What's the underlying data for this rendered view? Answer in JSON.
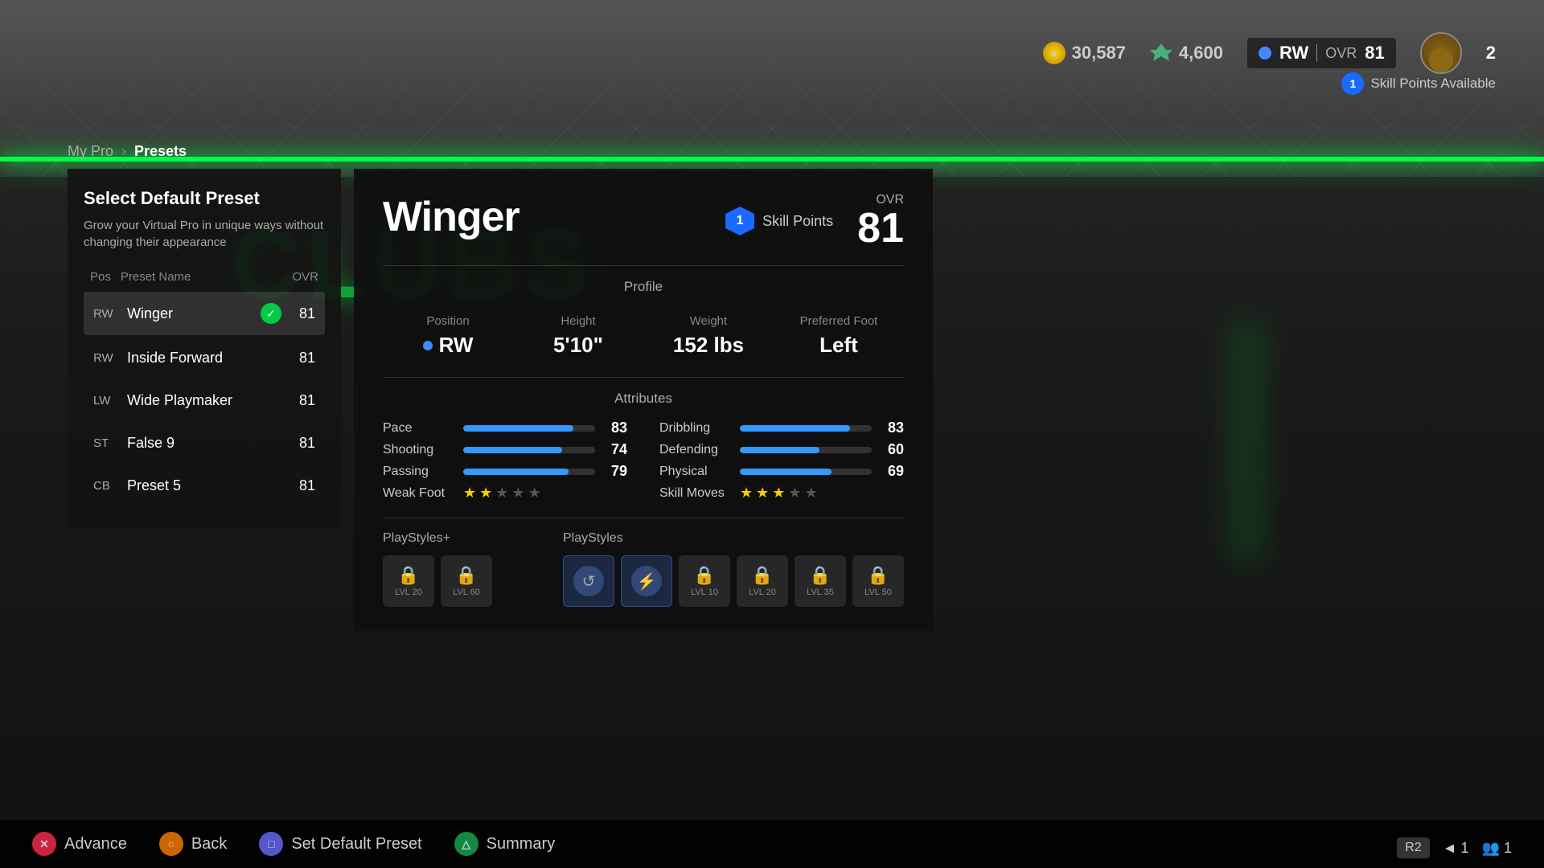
{
  "background": {
    "clubsText": "CLUBS"
  },
  "topHud": {
    "currency1": "30,587",
    "currency2": "4,600",
    "playerPos": "RW",
    "ovrLabel": "OVR",
    "ovrValue": "81",
    "playerNumber": "2",
    "skillPointsAvailLabel": "Skill Points Available",
    "skillPointsCount": "1"
  },
  "breadcrumb": {
    "root": "My Pro",
    "current": "Presets"
  },
  "leftPanel": {
    "title": "Select Default Preset",
    "description": "Grow your Virtual Pro in unique ways without changing their appearance",
    "headers": {
      "pos": "Pos",
      "name": "Preset Name",
      "ovr": "OVR"
    },
    "presets": [
      {
        "pos": "RW",
        "name": "Winger",
        "ovr": "81",
        "selected": true
      },
      {
        "pos": "RW",
        "name": "Inside Forward",
        "ovr": "81",
        "selected": false
      },
      {
        "pos": "LW",
        "name": "Wide Playmaker",
        "ovr": "81",
        "selected": false
      },
      {
        "pos": "ST",
        "name": "False 9",
        "ovr": "81",
        "selected": false
      },
      {
        "pos": "CB",
        "name": "Preset 5",
        "ovr": "81",
        "selected": false
      }
    ]
  },
  "mainCard": {
    "title": "Winger",
    "skillPointsBadgeNum": "1",
    "skillPointsLabel": "Skill Points",
    "ovrLabel": "OVR",
    "ovrValue": "81",
    "profileLabel": "Profile",
    "profile": {
      "posLabel": "Position",
      "posValue": "RW",
      "heightLabel": "Height",
      "heightValue": "5'10\"",
      "weightLabel": "Weight",
      "weightValue": "152 lbs",
      "footLabel": "Preferred Foot",
      "footValue": "Left"
    },
    "attributesLabel": "Attributes",
    "attributes": {
      "left": [
        {
          "name": "Pace",
          "value": 83,
          "max": 99
        },
        {
          "name": "Shooting",
          "value": 74,
          "max": 99
        },
        {
          "name": "Passing",
          "value": 79,
          "max": 99
        },
        {
          "name": "Weak Foot",
          "value": 2,
          "stars": true,
          "total": 5
        }
      ],
      "right": [
        {
          "name": "Dribbling",
          "value": 83,
          "max": 99
        },
        {
          "name": "Defending",
          "value": 60,
          "max": 99
        },
        {
          "name": "Physical",
          "value": 69,
          "max": 99
        },
        {
          "name": "Skill Moves",
          "value": 3,
          "stars": true,
          "total": 5
        }
      ]
    },
    "playStylesPlus": {
      "label": "PlayStyles+",
      "icons": [
        {
          "locked": true,
          "level": "LVL 20"
        },
        {
          "locked": true,
          "level": "LVL 60"
        }
      ]
    },
    "playStyles": {
      "label": "PlayStyles",
      "icons": [
        {
          "locked": false,
          "symbol": "↺"
        },
        {
          "locked": false,
          "symbol": "⚡"
        },
        {
          "locked": true,
          "level": "LVL 10"
        },
        {
          "locked": true,
          "level": "LVL 20"
        },
        {
          "locked": true,
          "level": "LVL 35"
        },
        {
          "locked": true,
          "level": "LVL 50"
        }
      ]
    }
  },
  "bottomNav": {
    "buttons": [
      {
        "icon": "✕",
        "style": "btn-x",
        "label": "Advance"
      },
      {
        "icon": "○",
        "style": "btn-o",
        "label": "Back"
      },
      {
        "icon": "□",
        "style": "btn-sq",
        "label": "Set Default Preset"
      },
      {
        "icon": "△",
        "style": "btn-tri",
        "label": "Summary"
      }
    ],
    "rightBadge": "R2",
    "rightPageNum": "1",
    "rightGroupNum": "1"
  }
}
